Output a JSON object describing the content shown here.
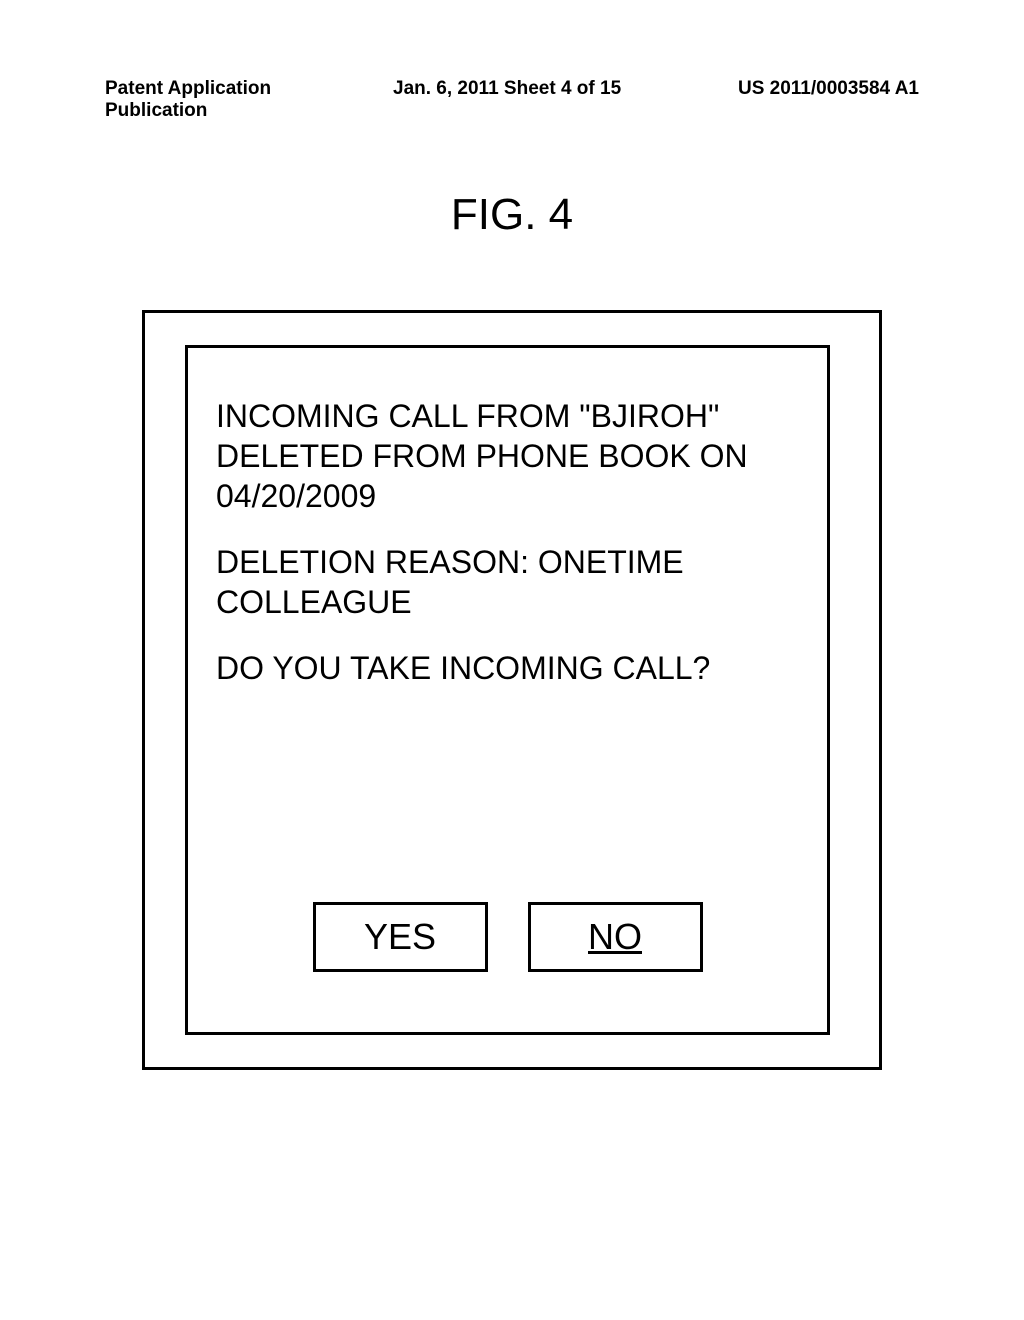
{
  "header": {
    "left": "Patent Application Publication",
    "center": "Jan. 6, 2011  Sheet 4 of 15",
    "right": "US 2011/0003584 A1"
  },
  "figure_label": "FIG. 4",
  "dialog": {
    "line1": "INCOMING CALL FROM \"BJIROH\" DELETED FROM PHONE BOOK ON 04/20/2009",
    "line2": "DELETION REASON:  ONETIME COLLEAGUE",
    "line3": "DO YOU TAKE INCOMING CALL?",
    "yes_label": "YES",
    "no_label": "NO"
  }
}
